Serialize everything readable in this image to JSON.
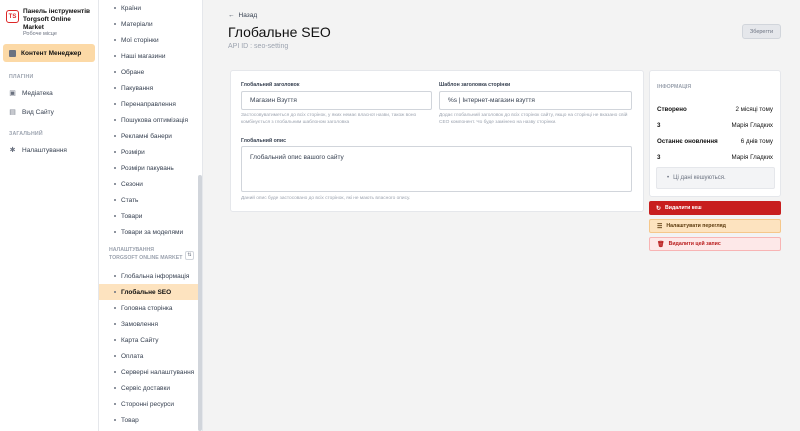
{
  "brand": {
    "logo_text": "TS",
    "title_line1": "Панель інструментів",
    "title_line2": "Torgsoft Online Market",
    "subtitle": "Робоче місце"
  },
  "nav": {
    "active_label": "Контент Менеджер",
    "section_plugins": "ПЛАГІНИ",
    "media": "Медіатека",
    "site_view": "Вид Сайту",
    "section_general": "ЗАГАЛЬНИЙ",
    "settings": "Налаштування"
  },
  "subnav": {
    "items": [
      "Країни",
      "Матеріали",
      "Мої сторінки",
      "Наші магазини",
      "Обране",
      "Пакування",
      "Перенаправлення",
      "Пошукова оптимізація",
      "Рекламні банери",
      "Розміри",
      "Розміри пакувань",
      "Сезони",
      "Стать",
      "Товари",
      "Товари за моделями"
    ],
    "group_label_line1": "НАЛАШТУВАННЯ",
    "group_label_line2": "TORGSOFT ONLINE MARKET",
    "group_items": [
      "Глобальна інформація",
      "Глобальне SEO",
      "Головна сторінка",
      "Замовлення",
      "Карта Сайту",
      "Оплата",
      "Серверні налаштування",
      "Сервіс доставки",
      "Сторонні ресурси",
      "Товар"
    ],
    "active_index": 1
  },
  "header": {
    "back": "Назад",
    "title": "Глобальне SEO",
    "api_id": "API ID : seo-setting",
    "save": "Зберегти"
  },
  "form": {
    "global_title_label": "Глобальний заголовок",
    "global_title_value": "Магазин Взуття",
    "global_title_help": "Застосовуватиметься до всіх сторінок, у яких немає власної назви, також воно комбінується з глобальним шаблоном заголовка",
    "template_label": "Шаблон заголовка сторінки",
    "template_value": "%s | Інтернет-магазин взуття",
    "template_help": "Додає глобальний заголовок до всіх сторінок сайту, якщо на сторінці не вказано свій СЕО компонент. Чо буде замінено на назву сторінки.",
    "desc_label": "Глобальний опис",
    "desc_value": "Глобальний опис вашого сайту",
    "desc_help": "Даний опис буде застосовано до всіх сторінок, які не мають власного опису."
  },
  "info": {
    "heading": "ІНФОРМАЦІЯ",
    "created_label": "Створено",
    "created_value": "2 місяці тому",
    "created_by_id": "3",
    "created_by_name": "Марія Гладких",
    "updated_label": "Останнє оновлення",
    "updated_value": "6 днів тому",
    "updated_by_id": "3",
    "updated_by_name": "Марія Гладких",
    "cache_note": "Ці дані кешуються."
  },
  "actions": {
    "delete_cache": "Видалити кеш",
    "configure_view": "Налаштувати перегляд",
    "delete_entry": "Видалити цей запис"
  }
}
